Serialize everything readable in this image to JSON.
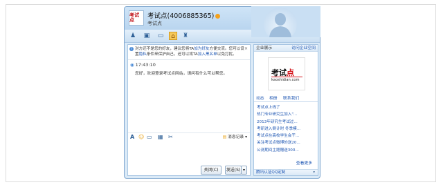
{
  "window": {
    "title": "考试点(4006885365)",
    "subtitle": "考试点",
    "avatar_text": "考试点"
  },
  "notice": {
    "text_1": "对方还不是您的好友，建议您将TA",
    "link_1": "加为好友",
    "text_2": "方便交流。您可以设置",
    "link_2": "隐私",
    "text_3": "条件来保护自己，还可以将TA",
    "link_3": "加入黑名单",
    "text_4": "以免打扰。"
  },
  "message": {
    "time": "17:43:10",
    "text": "您好，欢迎登录考试点网站，请问有什么可以帮您。"
  },
  "input_toolbar": {
    "history_label": "消息记录"
  },
  "buttons": {
    "close_label": "关闭(C)",
    "send_label": "发送(S)"
  },
  "sidebar": {
    "header": "企业展示",
    "header_link": "访问企业空间",
    "brand_main": "考试",
    "brand_main_red": "点",
    "brand_sub": "kaoshidian.com",
    "tabs": [
      "动态",
      "相册",
      "联系我们"
    ],
    "news": [
      "考试点上线了",
      "热门专业研究生加入\"...",
      "2013年研究生考试过...",
      "考研进入倒计时 冬季模...",
      "考试点在高校学生会干...",
      "关注考试点微博的送20...",
      "公测期间主题赠送300..."
    ],
    "more": "查看更多",
    "footer": "腾讯认证QQ定制"
  }
}
